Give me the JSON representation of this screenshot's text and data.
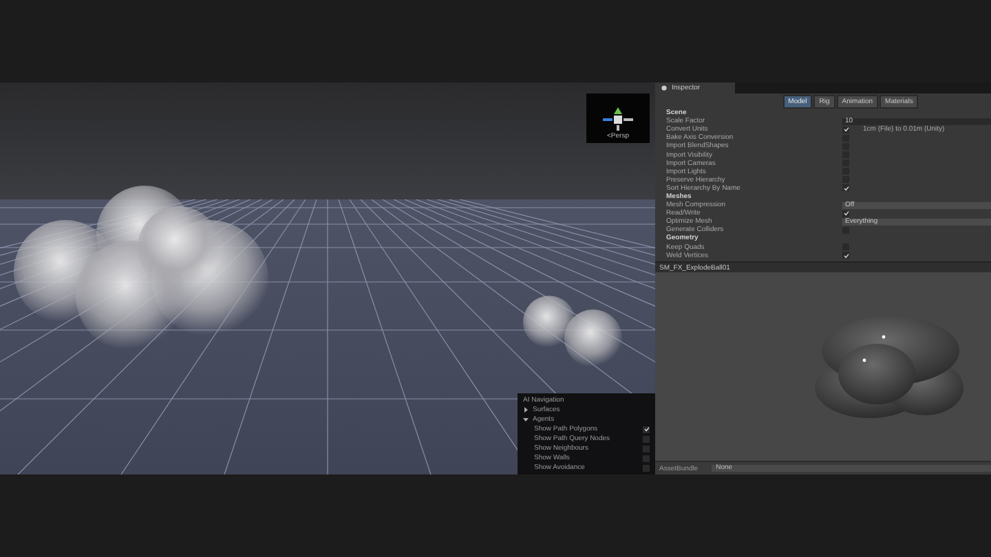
{
  "scene_view": {
    "gizmo_label": "<Persp",
    "navigation_overlay": {
      "title": "AI Navigation",
      "sections": [
        {
          "label": "Surfaces",
          "expanded": false
        },
        {
          "label": "Agents",
          "expanded": true,
          "options": [
            {
              "label": "Show Path Polygons",
              "checked": true
            },
            {
              "label": "Show Path Query Nodes",
              "checked": false
            },
            {
              "label": "Show Neighbours",
              "checked": false
            },
            {
              "label": "Show Walls",
              "checked": false
            },
            {
              "label": "Show Avoidance",
              "checked": false
            }
          ]
        }
      ]
    }
  },
  "inspector": {
    "tab": "Inspector",
    "tabs": [
      {
        "label": "Model",
        "selected": true
      },
      {
        "label": "Rig",
        "selected": false
      },
      {
        "label": "Animation",
        "selected": false
      },
      {
        "label": "Materials",
        "selected": false
      }
    ],
    "rows": [
      {
        "kind": "header",
        "label": "Scene"
      },
      {
        "kind": "field",
        "label": "Scale Factor",
        "value": "10"
      },
      {
        "kind": "checkbox",
        "label": "Convert Units",
        "checked": true,
        "note": "1cm (File) to 0.01m (Unity)"
      },
      {
        "kind": "checkbox",
        "label": "Bake Axis Conversion",
        "checked": false
      },
      {
        "kind": "checkbox",
        "label": "Import BlendShapes",
        "checked": false
      },
      {
        "kind": "checkbox",
        "label": "Import Visibility",
        "checked": false
      },
      {
        "kind": "checkbox",
        "label": "Import Cameras",
        "checked": false
      },
      {
        "kind": "checkbox",
        "label": "Import Lights",
        "checked": false
      },
      {
        "kind": "checkbox",
        "label": "Preserve Hierarchy",
        "checked": false
      },
      {
        "kind": "checkbox",
        "label": "Sort Hierarchy By Name",
        "checked": true
      },
      {
        "kind": "header",
        "label": "Meshes"
      },
      {
        "kind": "dropdown",
        "label": "Mesh Compression",
        "value": "Off"
      },
      {
        "kind": "checkbox",
        "label": "Read/Write",
        "checked": true
      },
      {
        "kind": "dropdown",
        "label": "Optimize Mesh",
        "value": "Everything"
      },
      {
        "kind": "checkbox",
        "label": "Generate Colliders",
        "checked": false
      },
      {
        "kind": "header",
        "label": "Geometry"
      },
      {
        "kind": "checkbox",
        "label": "Keep Quads",
        "checked": false
      },
      {
        "kind": "checkbox",
        "label": "Weld Vertices",
        "checked": true
      }
    ],
    "preview_title": "SM_FX_ExplodeBall01",
    "asset_bundle": {
      "label": "AssetBundle",
      "value": "None"
    }
  }
}
